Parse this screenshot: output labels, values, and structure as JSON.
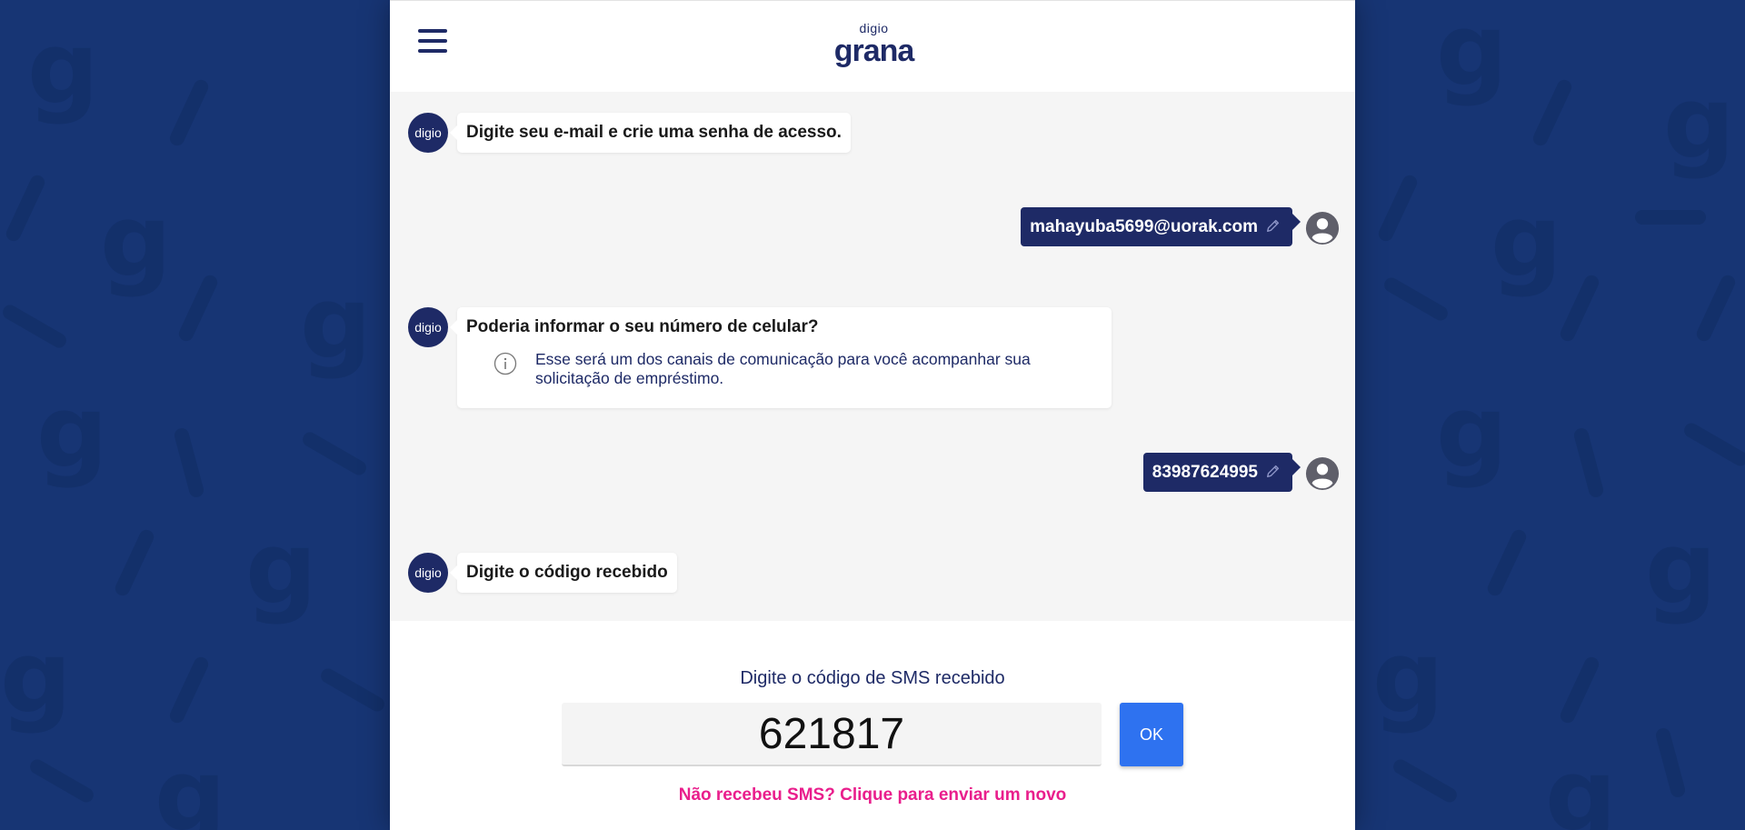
{
  "header": {
    "logo_small": "digio",
    "logo_main": "grana"
  },
  "bot_avatar_label": "digio",
  "messages": [
    {
      "from": "bot",
      "text": "Digite seu e-mail e crie uma senha de acesso."
    },
    {
      "from": "user",
      "text": "mahayuba5699@uorak.com"
    },
    {
      "from": "bot",
      "text": "Poderia informar o seu número de celular?",
      "info": "Esse será um dos canais de comunicação para você acompanhar sua solicitação de empréstimo."
    },
    {
      "from": "user",
      "text": "83987624995"
    },
    {
      "from": "bot",
      "text": "Digite o código recebido"
    }
  ],
  "footer": {
    "label": "Digite o código de SMS recebido",
    "code_value": "621817",
    "ok_label": "OK",
    "resend_link": "Não recebeu SMS? Clique para enviar um novo"
  },
  "colors": {
    "brand_navy": "#1e2a66",
    "background_blue": "#173574",
    "button_blue": "#2e72f0",
    "link_pink": "#e91e8c"
  },
  "icons": [
    "menu-icon",
    "edit-pencil-icon",
    "user-avatar-icon",
    "info-icon"
  ]
}
